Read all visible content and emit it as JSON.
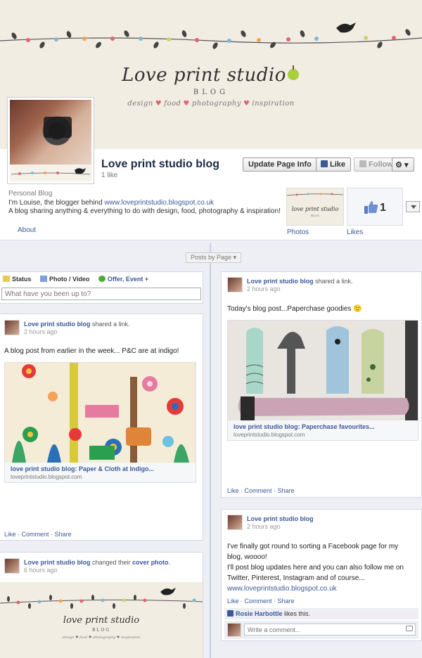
{
  "cover": {
    "brand_main": "Love print studio",
    "brand_sub": "BLOG",
    "brand_tag": [
      "design",
      "food",
      "photography",
      "inspiration"
    ]
  },
  "page": {
    "name": "Love print studio blog",
    "likes": "1 like",
    "buttons": {
      "update": "Update Page Info",
      "like": "Like",
      "follow": "Follow"
    },
    "about": {
      "category": "Personal Blog",
      "line1_prefix": "I'm Louise, the blogger behind ",
      "line1_link": "www.loveprintstudio.blogspot.co.uk",
      "line2": "A blog sharing anything & everything to do with design, food, photography & inspiration!",
      "about_label": "About"
    },
    "photos_label": "Photos",
    "likes_label": "Likes",
    "likes_number": "1"
  },
  "timeline": {
    "filter": "Posts by Page ▾",
    "composer": {
      "tabs": [
        "Status",
        "Photo / Video",
        "Offer, Event +"
      ],
      "placeholder": "What have you been up to?"
    },
    "left_posts": [
      {
        "author": "Love print studio blog",
        "action": " shared a link.",
        "time": "2 hours ago",
        "text": "A blog post from earlier in the week... P&C are at indigo!",
        "link_title": "love print studio blog: Paper & Cloth at Indigo...",
        "link_url": "loveprintstudio.blogspot.com",
        "actions": "Like · Comment · Share"
      },
      {
        "author": "Love print studio blog",
        "action_prefix": " changed their ",
        "action_link": "cover photo",
        "action_suffix": ".",
        "time": "6 hours ago"
      }
    ],
    "right_posts": [
      {
        "author": "Love print studio blog",
        "action": " shared a link.",
        "time": "2 hours ago",
        "text": "Today's blog post...Paperchase goodies 🙂",
        "link_title": "love print studio blog: Paperchase favourites...",
        "link_url": "loveprintstudio.blogspot.com",
        "actions": "Like · Comment · Share"
      },
      {
        "author": "Love print studio blog",
        "time": "2 hours ago",
        "text_lines": [
          "I've finally got round to sorting a Facebook page for my",
          "blog, woooo!",
          "I'll post blog updates here and you can also follow me on",
          "Twitter, Pinterest, Instagram and of course...",
          "www.loveprintstudio.blogspot.co.uk"
        ],
        "actions": "Like · Comment · Share",
        "liker": "Rosie Harbottle",
        "likes_this": " likes this.",
        "comment_placeholder": "Write a comment..."
      }
    ]
  },
  "colors": {
    "fb_blue": "#3b5998",
    "cover_bg": "#f2ede3",
    "timeline_bg": "#edeff4"
  }
}
